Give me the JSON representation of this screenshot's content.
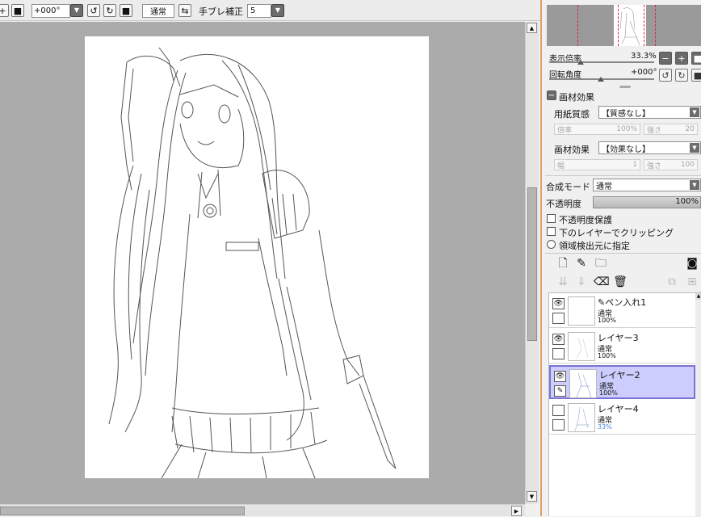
{
  "toolbar": {
    "rotation_value": "+000°",
    "blend_button": "通常",
    "stabilizer_label": "手ブレ補正",
    "stabilizer_value": "5"
  },
  "navigator": {
    "zoom_label": "表示倍率",
    "zoom_value": "33.3%",
    "angle_label": "回転角度",
    "angle_value": "+000°"
  },
  "material": {
    "section_label": "画材効果",
    "paper_label": "用紙質感",
    "paper_value": "【質感なし】",
    "paper_scale_label": "倍率",
    "paper_scale_value": "100%",
    "paper_strength_label": "強さ",
    "paper_strength_value": "20",
    "effect_label": "画材効果",
    "effect_value": "【効果なし】",
    "effect_width_label": "幅",
    "effect_width_value": "1",
    "effect_strength_label": "強さ",
    "effect_strength_value": "100"
  },
  "layer_props": {
    "blend_label": "合成モード",
    "blend_value": "通常",
    "opacity_label": "不透明度",
    "opacity_value": "100%",
    "protect_opacity": "不透明度保護",
    "clip_lower": "下のレイヤーでクリッピング",
    "region_source": "領域検出元に指定"
  },
  "layers": [
    {
      "name": "ペン入れ1",
      "mode": "通常",
      "opacity": "100%",
      "visible": true,
      "selected": false,
      "pen": false,
      "vector": true
    },
    {
      "name": "レイヤー3",
      "mode": "通常",
      "opacity": "100%",
      "visible": true,
      "selected": false,
      "pen": false,
      "vector": false
    },
    {
      "name": "レイヤー2",
      "mode": "通常",
      "opacity": "100%",
      "visible": true,
      "selected": true,
      "pen": true,
      "vector": false
    },
    {
      "name": "レイヤー4",
      "mode": "通常",
      "opacity": "33%",
      "visible": false,
      "selected": false,
      "pen": false,
      "vector": false
    }
  ],
  "icons": {
    "eye": "👁",
    "pen": "✎"
  },
  "colors": {
    "canvas_bg": "#ababab",
    "selected_layer": "#cccdfc",
    "selected_border": "#7b72d6",
    "nav_guide": "#e0243c"
  }
}
